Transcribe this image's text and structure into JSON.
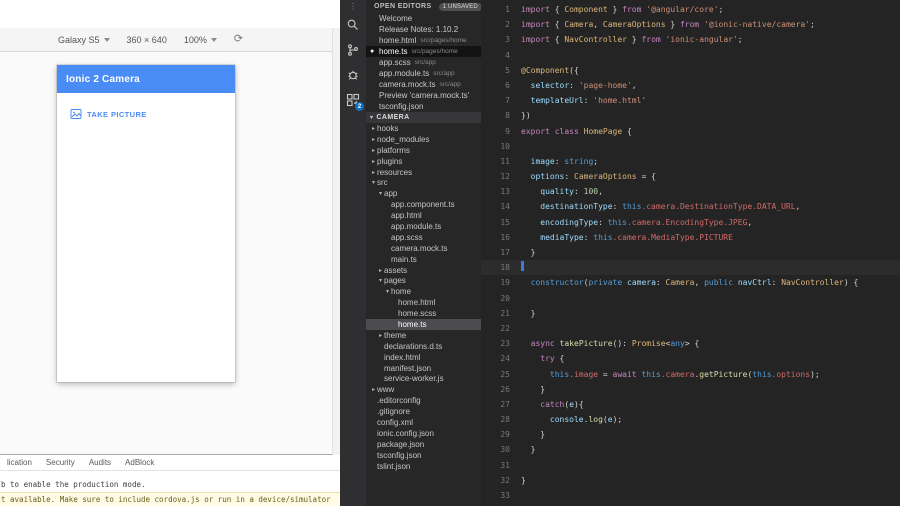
{
  "browser": {
    "toolbar": {
      "device": "Galaxy S5",
      "dims": "360 × 640",
      "zoom": "100%"
    },
    "app": {
      "title": "Ionic 2 Camera",
      "take_picture": "TAKE PICTURE"
    },
    "devtools": {
      "tabs": [
        "lication",
        "Security",
        "Audits",
        "AdBlock"
      ],
      "console": [
        {
          "text": "b to enable the production mode.",
          "warn": false
        },
        {
          "text": "t available. Make sure to include cordova.js or run in a device/simulator",
          "warn": true
        }
      ]
    }
  },
  "activity_bar": {
    "badge": "2"
  },
  "sidebar": {
    "open_editors": {
      "label": "OPEN EDITORS",
      "badge": "1 UNSAVED",
      "items": [
        {
          "n": "Welcome",
          "d": ""
        },
        {
          "n": "Release Notes: 1.10.2",
          "d": ""
        },
        {
          "n": "home.html",
          "d": "src/pages/home"
        },
        {
          "n": "home.ts",
          "d": "src/pages/home",
          "active": true,
          "dirty": true
        },
        {
          "n": "app.scss",
          "d": "src/app"
        },
        {
          "n": "app.module.ts",
          "d": "src/app"
        },
        {
          "n": "camera.mock.ts",
          "d": "src/app"
        },
        {
          "n": "Preview 'camera.mock.ts'",
          "d": ""
        },
        {
          "n": "tsconfig.json",
          "d": ""
        }
      ]
    },
    "explorer": {
      "root": "CAMERA",
      "tree": [
        {
          "l": "hooks",
          "i": 0,
          "t": "dc"
        },
        {
          "l": "node_modules",
          "i": 0,
          "t": "dc"
        },
        {
          "l": "platforms",
          "i": 0,
          "t": "dc"
        },
        {
          "l": "plugins",
          "i": 0,
          "t": "dc"
        },
        {
          "l": "resources",
          "i": 0,
          "t": "dc"
        },
        {
          "l": "src",
          "i": 0,
          "t": "de"
        },
        {
          "l": "app",
          "i": 1,
          "t": "de"
        },
        {
          "l": "app.component.ts",
          "i": 2,
          "t": "f"
        },
        {
          "l": "app.html",
          "i": 2,
          "t": "f"
        },
        {
          "l": "app.module.ts",
          "i": 2,
          "t": "f"
        },
        {
          "l": "app.scss",
          "i": 2,
          "t": "f"
        },
        {
          "l": "camera.mock.ts",
          "i": 2,
          "t": "f"
        },
        {
          "l": "main.ts",
          "i": 2,
          "t": "f"
        },
        {
          "l": "assets",
          "i": 1,
          "t": "dc"
        },
        {
          "l": "pages",
          "i": 1,
          "t": "de"
        },
        {
          "l": "home",
          "i": 2,
          "t": "de"
        },
        {
          "l": "home.html",
          "i": 3,
          "t": "f"
        },
        {
          "l": "home.scss",
          "i": 3,
          "t": "f"
        },
        {
          "l": "home.ts",
          "i": 3,
          "t": "f",
          "sel": true
        },
        {
          "l": "theme",
          "i": 1,
          "t": "dc"
        },
        {
          "l": "declarations.d.ts",
          "i": 1,
          "t": "f"
        },
        {
          "l": "index.html",
          "i": 1,
          "t": "f"
        },
        {
          "l": "manifest.json",
          "i": 1,
          "t": "f"
        },
        {
          "l": "service-worker.js",
          "i": 1,
          "t": "f"
        },
        {
          "l": "www",
          "i": 0,
          "t": "dc"
        },
        {
          "l": ".editorconfig",
          "i": 0,
          "t": "f"
        },
        {
          "l": ".gitignore",
          "i": 0,
          "t": "f"
        },
        {
          "l": "config.xml",
          "i": 0,
          "t": "f"
        },
        {
          "l": "ionic.config.json",
          "i": 0,
          "t": "f"
        },
        {
          "l": "package.json",
          "i": 0,
          "t": "f"
        },
        {
          "l": "tsconfig.json",
          "i": 0,
          "t": "f"
        },
        {
          "l": "tslint.json",
          "i": 0,
          "t": "f"
        }
      ]
    }
  },
  "editor": {
    "lines": [
      {
        "t": [
          [
            "k",
            "import"
          ],
          [
            "d",
            " { "
          ],
          [
            "t",
            "Component"
          ],
          [
            "d",
            " } "
          ],
          [
            "k",
            "from"
          ],
          [
            "d",
            " "
          ],
          [
            "s",
            "'@angular/core'"
          ],
          [
            "d",
            ";"
          ]
        ]
      },
      {
        "t": [
          [
            "k",
            "import"
          ],
          [
            "d",
            " { "
          ],
          [
            "t",
            "Camera"
          ],
          [
            "d",
            ", "
          ],
          [
            "t",
            "CameraOptions"
          ],
          [
            "d",
            " } "
          ],
          [
            "k",
            "from"
          ],
          [
            "d",
            " "
          ],
          [
            "s",
            "'@ionic-native/camera'"
          ],
          [
            "d",
            ";"
          ]
        ]
      },
      {
        "t": [
          [
            "k",
            "import"
          ],
          [
            "d",
            " { "
          ],
          [
            "t",
            "NavController"
          ],
          [
            "d",
            " } "
          ],
          [
            "k",
            "from"
          ],
          [
            "d",
            " "
          ],
          [
            "s",
            "'ionic-angular'"
          ],
          [
            "d",
            ";"
          ]
        ]
      },
      {
        "t": []
      },
      {
        "t": [
          [
            "t",
            "@Component"
          ],
          [
            "d",
            "({"
          ]
        ]
      },
      {
        "t": [
          [
            "d",
            "  "
          ],
          [
            "p",
            "selector"
          ],
          [
            "d",
            ": "
          ],
          [
            "s",
            "'page-home'"
          ],
          [
            "d",
            ","
          ]
        ]
      },
      {
        "t": [
          [
            "d",
            "  "
          ],
          [
            "p",
            "templateUrl"
          ],
          [
            "d",
            ": "
          ],
          [
            "s",
            "'home.html'"
          ]
        ]
      },
      {
        "t": [
          [
            "d",
            "})"
          ]
        ]
      },
      {
        "t": [
          [
            "k",
            "export"
          ],
          [
            "d",
            " "
          ],
          [
            "k",
            "class"
          ],
          [
            "d",
            " "
          ],
          [
            "t",
            "HomePage"
          ],
          [
            "d",
            " {"
          ]
        ]
      },
      {
        "t": []
      },
      {
        "t": [
          [
            "d",
            "  "
          ],
          [
            "p",
            "image"
          ],
          [
            "d",
            ": "
          ],
          [
            "kb",
            "string"
          ],
          [
            "d",
            ";"
          ]
        ]
      },
      {
        "t": [
          [
            "d",
            "  "
          ],
          [
            "p",
            "options"
          ],
          [
            "d",
            ": "
          ],
          [
            "t",
            "CameraOptions"
          ],
          [
            "d",
            " = {"
          ]
        ]
      },
      {
        "t": [
          [
            "d",
            "    "
          ],
          [
            "p",
            "quality"
          ],
          [
            "d",
            ": "
          ],
          [
            "n",
            "100"
          ],
          [
            "d",
            ","
          ]
        ]
      },
      {
        "t": [
          [
            "d",
            "    "
          ],
          [
            "p",
            "destinationType"
          ],
          [
            "d",
            ": "
          ],
          [
            "kb",
            "this"
          ],
          [
            "m",
            ".camera.DestinationType.DATA_URL"
          ],
          [
            "d",
            ","
          ]
        ]
      },
      {
        "t": [
          [
            "d",
            "    "
          ],
          [
            "p",
            "encodingType"
          ],
          [
            "d",
            ": "
          ],
          [
            "kb",
            "this"
          ],
          [
            "m",
            ".camera.EncodingType.JPEG"
          ],
          [
            "d",
            ","
          ]
        ]
      },
      {
        "t": [
          [
            "d",
            "    "
          ],
          [
            "p",
            "mediaType"
          ],
          [
            "d",
            ": "
          ],
          [
            "kb",
            "this"
          ],
          [
            "m",
            ".camera.MediaType.PICTURE"
          ]
        ]
      },
      {
        "t": [
          [
            "d",
            "  }"
          ]
        ]
      },
      {
        "t": [],
        "cursor": true
      },
      {
        "t": [
          [
            "d",
            "  "
          ],
          [
            "kb",
            "constructor"
          ],
          [
            "d",
            "("
          ],
          [
            "kb",
            "private"
          ],
          [
            "d",
            " "
          ],
          [
            "p",
            "camera"
          ],
          [
            "d",
            ": "
          ],
          [
            "t",
            "Camera"
          ],
          [
            "d",
            ", "
          ],
          [
            "kb",
            "public"
          ],
          [
            "d",
            " "
          ],
          [
            "p",
            "navCtrl"
          ],
          [
            "d",
            ": "
          ],
          [
            "t",
            "NavController"
          ],
          [
            "d",
            ") {"
          ]
        ]
      },
      {
        "t": []
      },
      {
        "t": [
          [
            "d",
            "  }"
          ]
        ]
      },
      {
        "t": []
      },
      {
        "t": [
          [
            "d",
            "  "
          ],
          [
            "k",
            "async"
          ],
          [
            "d",
            " "
          ],
          [
            "f",
            "takePicture"
          ],
          [
            "d",
            "(): "
          ],
          [
            "t",
            "Promise"
          ],
          [
            "d",
            "<"
          ],
          [
            "kb",
            "any"
          ],
          [
            "d",
            "> {"
          ]
        ]
      },
      {
        "t": [
          [
            "d",
            "    "
          ],
          [
            "k",
            "try"
          ],
          [
            "d",
            " {"
          ]
        ]
      },
      {
        "t": [
          [
            "d",
            "      "
          ],
          [
            "kb",
            "this"
          ],
          [
            "m",
            ".image"
          ],
          [
            "d",
            " = "
          ],
          [
            "k",
            "await"
          ],
          [
            "d",
            " "
          ],
          [
            "kb",
            "this"
          ],
          [
            "m",
            ".camera"
          ],
          [
            "d",
            "."
          ],
          [
            "f",
            "getPicture"
          ],
          [
            "d",
            "("
          ],
          [
            "kb",
            "this"
          ],
          [
            "m",
            ".options"
          ],
          [
            "d",
            ");"
          ]
        ]
      },
      {
        "t": [
          [
            "d",
            "    }"
          ]
        ]
      },
      {
        "t": [
          [
            "d",
            "    "
          ],
          [
            "k",
            "catch"
          ],
          [
            "d",
            "("
          ],
          [
            "p",
            "e"
          ],
          [
            "d",
            "){"
          ]
        ]
      },
      {
        "t": [
          [
            "d",
            "      "
          ],
          [
            "p",
            "console"
          ],
          [
            "d",
            "."
          ],
          [
            "f",
            "log"
          ],
          [
            "d",
            "("
          ],
          [
            "p",
            "e"
          ],
          [
            "d",
            ");"
          ]
        ]
      },
      {
        "t": [
          [
            "d",
            "    }"
          ]
        ]
      },
      {
        "t": [
          [
            "d",
            "  }"
          ]
        ]
      },
      {
        "t": []
      },
      {
        "t": [
          [
            "d",
            "}"
          ]
        ]
      },
      {
        "t": []
      }
    ]
  }
}
